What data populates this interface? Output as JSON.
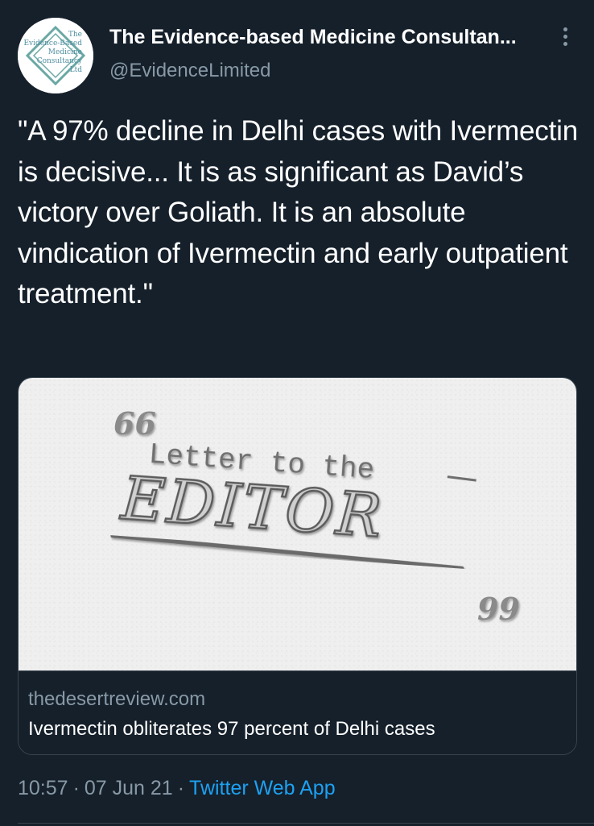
{
  "author": {
    "display_name": "The Evidence-based Medicine Consultan...",
    "handle": "@EvidenceLimited",
    "avatar_logo": {
      "line1": "The",
      "line2": "Evidence-Based",
      "line3": "Medicine",
      "line4": "Consultancy",
      "line5": "Ltd",
      "accent_color": "#6aa8a4"
    }
  },
  "tweet": {
    "text": "\"A 97% decline in Delhi cases with Ivermectin is decisive... It is as significant as David’s victory over Goliath. It is an absolute vindication of Ivermectin and early outpatient treatment.\""
  },
  "card": {
    "image": {
      "open_quote": "66",
      "line1": "Letter to the",
      "line2": "EDITOR",
      "close_quote": "99"
    },
    "domain": "thedesertreview.com",
    "title": "Ivermectin obliterates 97 percent of Delhi cases"
  },
  "footer": {
    "time": "10:57",
    "date": "07 Jun 21",
    "separator": "·",
    "source": "Twitter Web App"
  },
  "icons": {
    "more": "more-vertical-icon"
  },
  "colors": {
    "background": "#15202b",
    "secondary_text": "#8899a6",
    "link": "#1da1f2",
    "border": "#38444d"
  }
}
